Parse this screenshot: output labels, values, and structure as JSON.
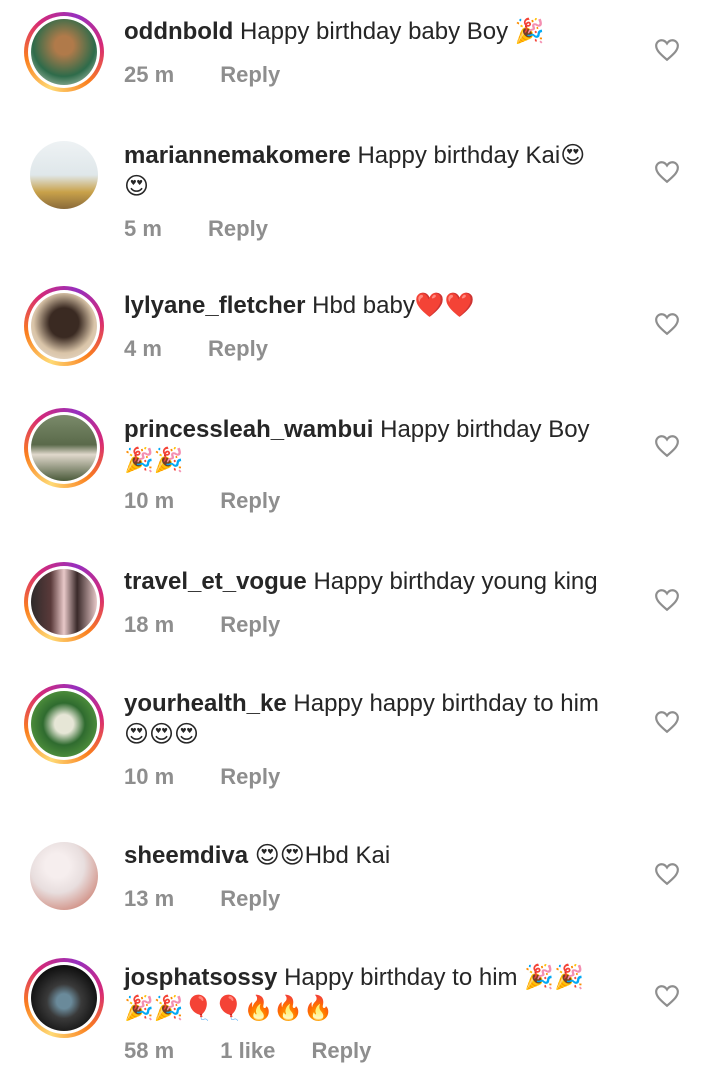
{
  "comments": [
    {
      "username": "oddnbold",
      "text": "Happy birthday baby Boy",
      "emoji": "🎉",
      "time": "25 m",
      "reply": "Reply",
      "story": true,
      "avatar_colors": [
        "#2e6b4a",
        "#b07a4a"
      ]
    },
    {
      "username": "mariannemakomere",
      "text": "Happy birthday Kai",
      "emoji": "😍",
      "emoji2": "😍",
      "time": "5 m",
      "reply": "Reply",
      "story": false,
      "avatar_colors": [
        "#dfe7ea",
        "#c9a24a"
      ]
    },
    {
      "username": "lylyane_fletcher",
      "text": "Hbd baby",
      "emoji": "❤️❤️",
      "time": "4 m",
      "reply": "Reply",
      "story": true,
      "avatar_colors": [
        "#d9c4a8",
        "#3a2a22"
      ]
    },
    {
      "username": "princessleah_wambui",
      "text": "Happy birthday Boy",
      "emoji": "🎉🎉",
      "time": "10 m",
      "reply": "Reply",
      "story": true,
      "avatar_colors": [
        "#5a6a4a",
        "#e0d8cc"
      ]
    },
    {
      "username": "travel_et_vogue",
      "text": "Happy birthday young king",
      "emoji": "",
      "time": "18 m",
      "reply": "Reply",
      "story": true,
      "avatar_colors": [
        "#2e2a2a",
        "#e8c8c8"
      ]
    },
    {
      "username": "yourhealth_ke",
      "text": "Happy happy birthday to him",
      "emoji": "😍😍😍",
      "time": "10 m",
      "reply": "Reply",
      "story": true,
      "avatar_colors": [
        "#2f6b2f",
        "#e6e6d6"
      ]
    },
    {
      "username": "sheemdiva",
      "text": "Hbd Kai",
      "emoji": "😍😍",
      "time": "13 m",
      "reply": "Reply",
      "story": false,
      "avatar_colors": [
        "#e8dede",
        "#d49a90"
      ]
    },
    {
      "username": "josphatsossy",
      "text": "Happy birthday to him",
      "emoji": "🎉🎉",
      "emoji2": "🎉🎉🎈🎈🔥🔥🔥",
      "time": "58 m",
      "likes": "1 like",
      "reply": "Reply",
      "story": true,
      "avatar_colors": [
        "#121212",
        "#6a8a9a"
      ]
    }
  ]
}
